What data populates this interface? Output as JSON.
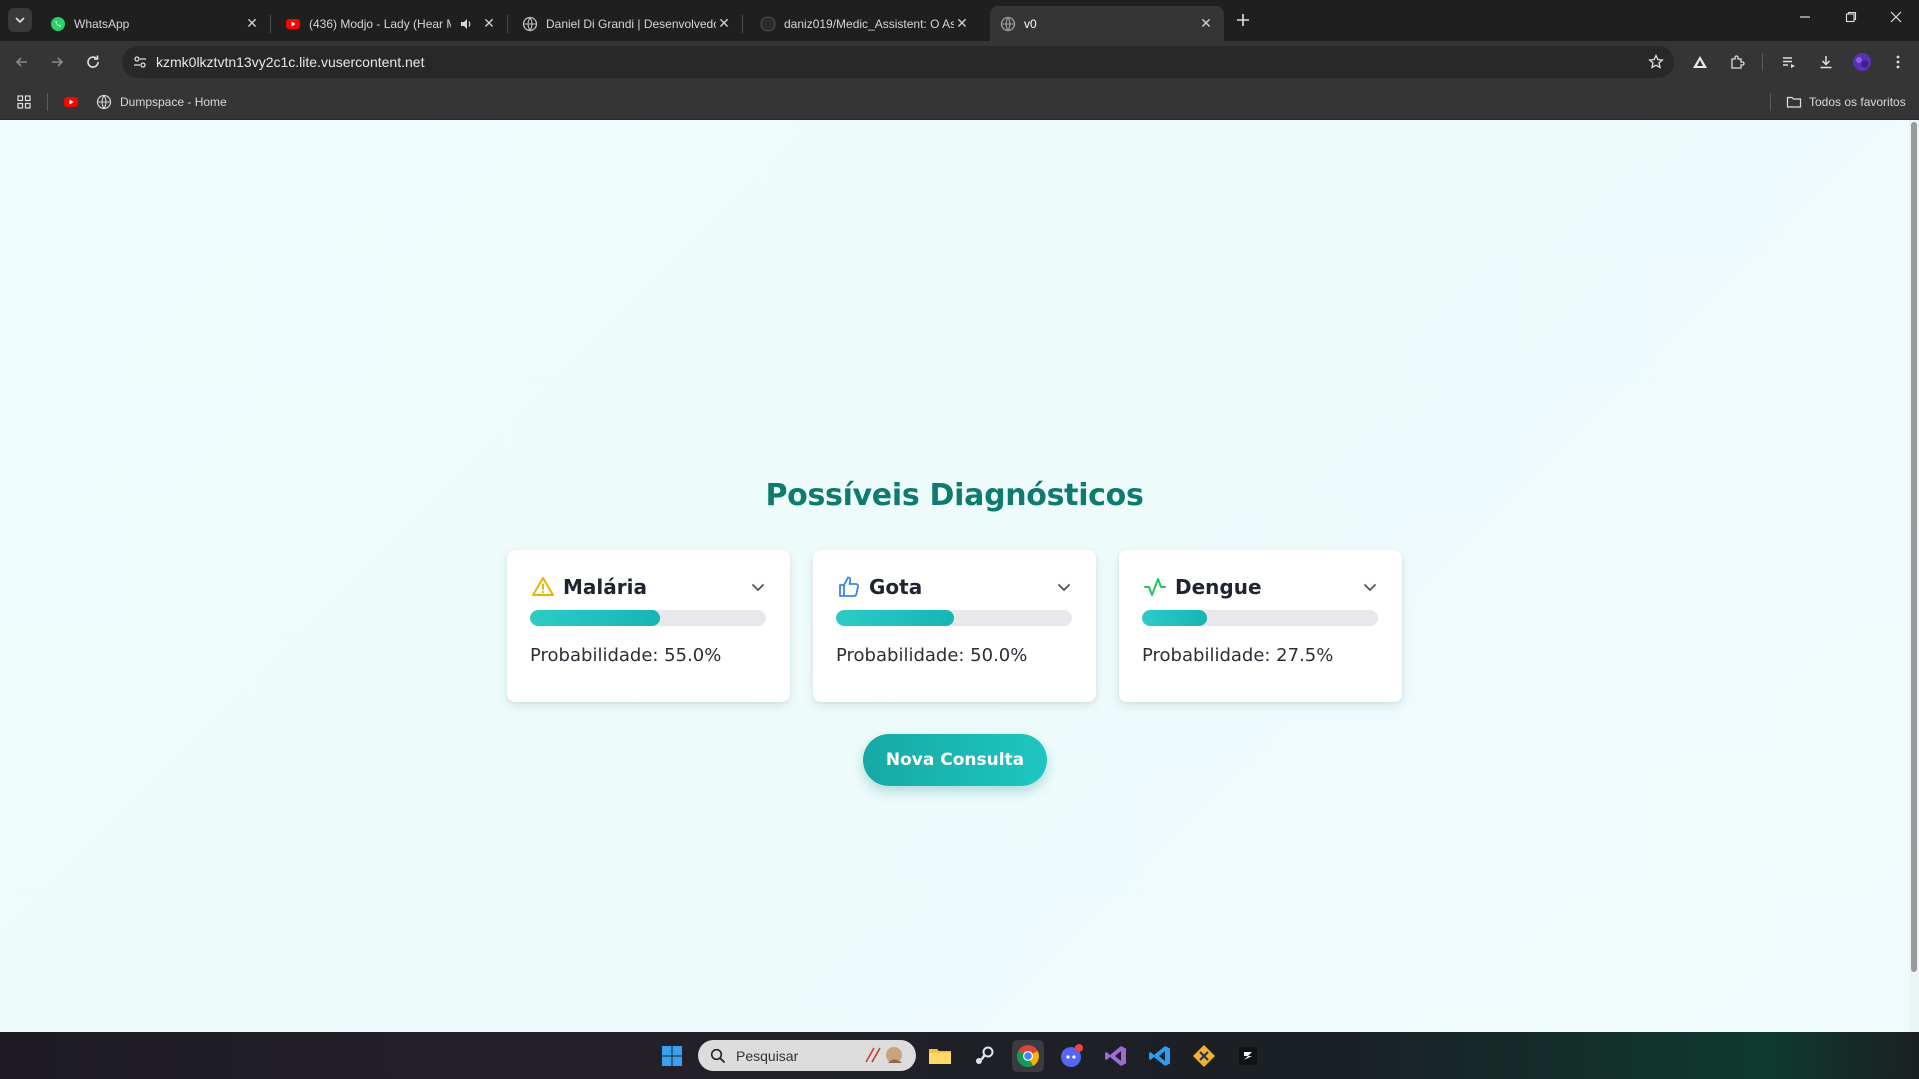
{
  "browser": {
    "tabs": [
      {
        "title": "WhatsApp",
        "icon": "whatsapp-icon"
      },
      {
        "title": "(436) Modjo - Lady (Hear M",
        "icon": "youtube-icon"
      },
      {
        "title": "Daniel Di Grandi | Desenvolvedo",
        "icon": "globe-icon"
      },
      {
        "title": "daniz019/Medic_Assistent: O As",
        "icon": "github-icon"
      },
      {
        "title": "v0",
        "icon": "globe-icon"
      }
    ],
    "url": "kzmk0lkztvtn13vy2c1c.lite.vusercontent.net",
    "bookmarks": [
      {
        "label": "Dumpspace - Home",
        "icon": "globe-icon"
      }
    ],
    "all_bookmarks_label": "Todos os favoritos"
  },
  "page": {
    "heading": "Possíveis Diagnósticos",
    "diagnoses": [
      {
        "name": "Malária",
        "probability_label": "Probabilidade: 55.0%",
        "probability": 55.0,
        "icon": "warning-icon",
        "icon_color": "#eab308"
      },
      {
        "name": "Gota",
        "probability_label": "Probabilidade: 50.0%",
        "probability": 50.0,
        "icon": "thumbs-up-icon",
        "icon_color": "#3b82f6"
      },
      {
        "name": "Dengue",
        "probability_label": "Probabilidade: 27.5%",
        "probability": 27.5,
        "icon": "activity-icon",
        "icon_color": "#22c55e"
      }
    ],
    "new_consult_label": "Nova Consulta",
    "accent_color": "#1ab8b3",
    "heading_color": "#0f7a6e"
  },
  "taskbar": {
    "search_placeholder": "Pesquisar"
  }
}
